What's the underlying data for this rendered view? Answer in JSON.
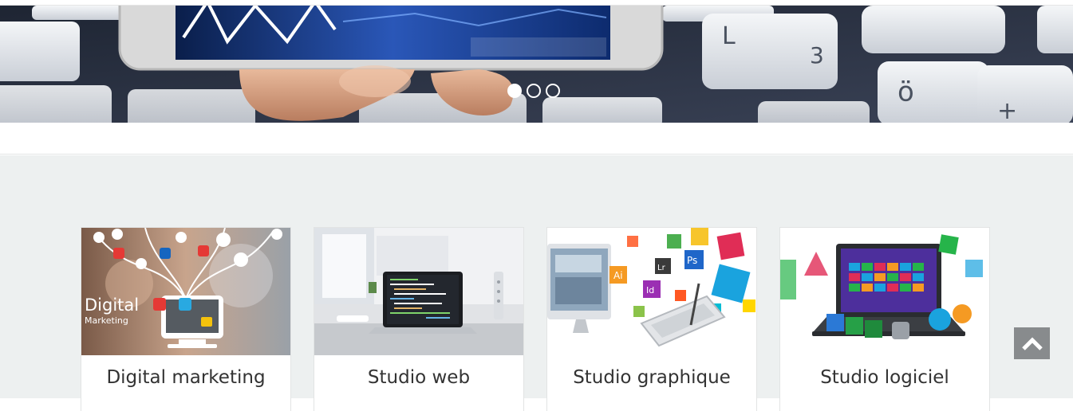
{
  "slider": {
    "dots": [
      {
        "active": true
      },
      {
        "active": false
      },
      {
        "active": false
      }
    ]
  },
  "services": [
    {
      "title": "Digital marketing",
      "image_text": "Digital",
      "image_subtext": "Marketing"
    },
    {
      "title": "Studio web"
    },
    {
      "title": "Studio graphique"
    },
    {
      "title": "Studio logiciel"
    }
  ],
  "colors": {
    "section_bg": "#edf0f0",
    "to_top_bg": "#888b8d"
  },
  "icons": {
    "to_top": "chevron-up-icon"
  }
}
